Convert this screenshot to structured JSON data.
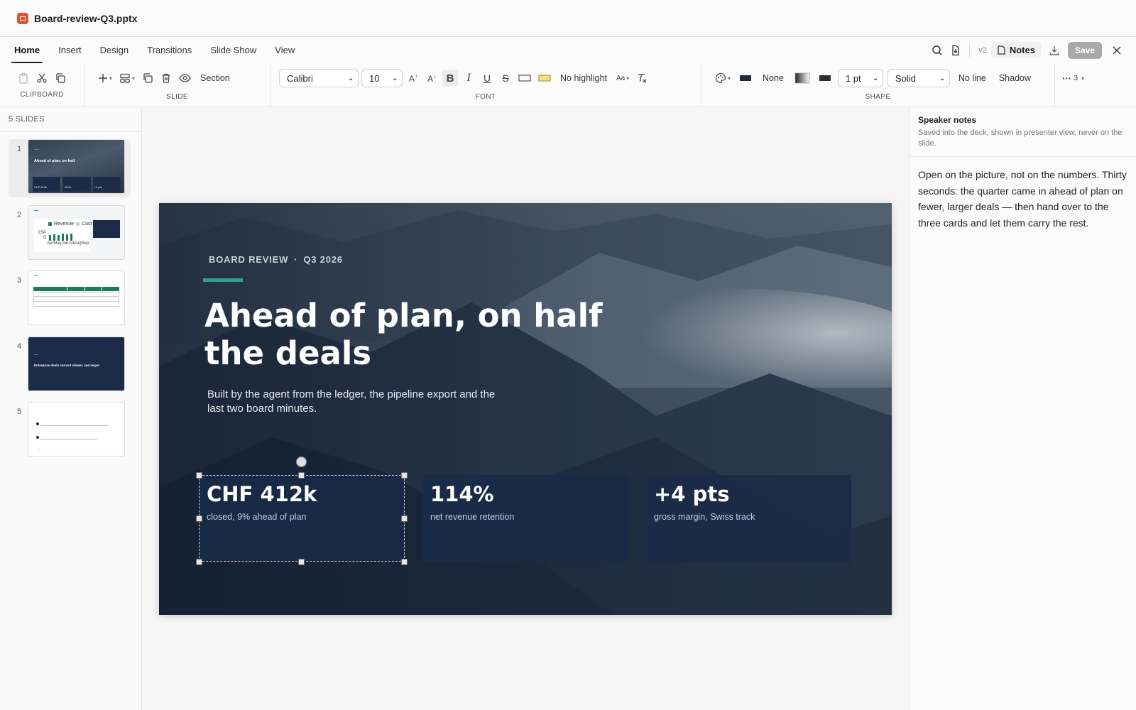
{
  "app": {
    "title": "Board-review-Q3.pptx"
  },
  "tabs": [
    "Home",
    "Insert",
    "Design",
    "Transitions",
    "Slide Show",
    "View"
  ],
  "toolbar_right": {
    "version": "v2",
    "notes_label": "Notes",
    "save_label": "Save"
  },
  "ribbon": {
    "clipboard_label": "CLIPBOARD",
    "slide_label": "SLIDE",
    "section_label": "Section",
    "font_label": "FONT",
    "font_name": "Calibri",
    "font_size": "10",
    "highlight_label": "No highlight",
    "shape_label": "SHAPE",
    "fill_label": "None",
    "line_weight": "1 pt",
    "line_style": "Solid",
    "no_line_label": "No line",
    "shadow_label": "Shadow",
    "more_count": "3"
  },
  "sidebar": {
    "header": "5 SLIDES",
    "slides": [
      {
        "num": "1",
        "title": "Ahead of plan, on half",
        "stats": [
          "CHF 412k",
          "114%",
          "+4 pts"
        ]
      },
      {
        "num": "2",
        "legend": [
          "Revenue",
          "Cost"
        ],
        "axis": [
          "194",
          "0"
        ],
        "months": [
          "Apr",
          "May",
          "Jun",
          "Jul",
          "Aug",
          "Sep"
        ]
      },
      {
        "num": "3"
      },
      {
        "num": "4",
        "title": "Enterprise deals convert slower, and larger."
      },
      {
        "num": "5"
      }
    ]
  },
  "slide": {
    "eyebrow_left": "BOARD REVIEW",
    "eyebrow_dot": "·",
    "eyebrow_right": "Q3 2026",
    "headline": "Ahead of plan, on half the deals",
    "subtitle": "Built by the agent from the ledger, the pipeline export and the last two board minutes.",
    "cards": [
      {
        "value": "CHF 412k",
        "label": "closed, 9% ahead of plan"
      },
      {
        "value": "114%",
        "label": "net revenue retention"
      },
      {
        "value": "+4 pts",
        "label": "gross margin, Swiss track"
      }
    ]
  },
  "notes": {
    "title": "Speaker notes",
    "hint": "Saved into the deck, shown in presenter view, never on the slide.",
    "body": "Open on the picture, not on the numbers. Thirty seconds: the quarter came in ahead of plan on fewer, larger deals — then hand over to the three cards and let them carry the rest."
  },
  "colors": {
    "accent": "#2f9e8c",
    "app_icon": "#e0512d",
    "card_bg": "#192a48",
    "thumb_dark": "#1b2b48",
    "table_green": "#1e7a5a"
  }
}
